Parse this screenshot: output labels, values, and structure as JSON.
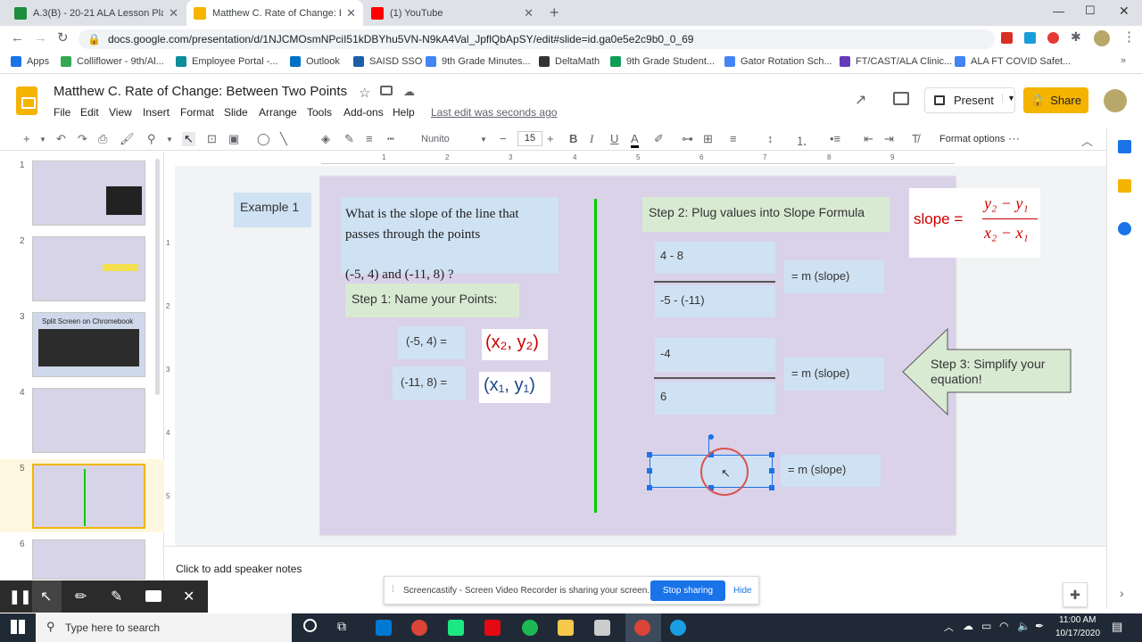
{
  "browser": {
    "tabs": [
      {
        "title": "A.3(B) - 20-21 ALA Lesson Plans/",
        "active": false
      },
      {
        "title": "Matthew C. Rate of Change: Betw",
        "active": true
      },
      {
        "title": "(1) YouTube",
        "active": false
      }
    ],
    "url": "docs.google.com/presentation/d/1NJCMOsmNPciI51kDBYhu5VN-N9kA4Val_JpflQbApSY/edit#slide=id.ga0e5e2c9b0_0_69",
    "bookmarks": [
      "Apps",
      "Colliflower - 9th/Al...",
      "Employee Portal -...",
      "Outlook",
      "SAISD SSO",
      "9th Grade Minutes...",
      "DeltaMath",
      "9th Grade Student...",
      "Gator Rotation Sch...",
      "FT/CAST/ALA Clinic...",
      "ALA FT COVID Safet..."
    ]
  },
  "doc": {
    "title": "Matthew C. Rate of Change: Between Two Points",
    "menus": [
      "File",
      "Edit",
      "View",
      "Insert",
      "Format",
      "Slide",
      "Arrange",
      "Tools",
      "Add-ons",
      "Help"
    ],
    "last_edit": "Last edit was seconds ago",
    "present_label": "Present",
    "share_label": "Share"
  },
  "toolbar": {
    "font": "Nunito",
    "font_size": "15",
    "format_options": "Format options"
  },
  "ruler": [
    "1",
    "2",
    "3",
    "4",
    "5",
    "6",
    "7",
    "8",
    "9"
  ],
  "vruler": [
    "1",
    "2",
    "3",
    "4",
    "5"
  ],
  "filmstrip": {
    "numbers": [
      "1",
      "2",
      "3",
      "4",
      "5",
      "6"
    ],
    "thumb3_title": "Split Screen on Chromebook"
  },
  "slide": {
    "example_label": "Example 1",
    "question": "What is the slope of the line that passes through the points",
    "points": "(-5, 4) and (-11, 8) ?",
    "step1": "Step 1: Name your Points:",
    "p1": "(-5, 4) =",
    "p2": "(-11, 8) =",
    "p1_name": "(x₂, y₂)",
    "p2_name": "(x₁, y₁)",
    "step2": "Step 2: Plug values into Slope Formula",
    "slope_word": "slope =",
    "formula_num": "y₂ − y₁",
    "formula_den": "x₂ − x₁",
    "frac1_num": "4 - 8",
    "frac1_den": "-5 - (-11)",
    "frac2_num": "-4",
    "frac2_den": "6",
    "m_slope": "= m (slope)",
    "step3": "Step 3: Simplify your equation!"
  },
  "notes_placeholder": "Click to add speaker notes",
  "screencastify": {
    "message": "Screencastify - Screen Video Recorder is sharing your screen.",
    "stop": "Stop sharing",
    "hide": "Hide"
  },
  "taskbar": {
    "search_placeholder": "Type here to search",
    "time": "11:00 AM",
    "date": "10/17/2020"
  },
  "colors": {
    "accent_yellow": "#f4b400",
    "slide_bg": "#d9d2e9",
    "box_blue": "#cfe2f3",
    "box_green": "#d9ead3",
    "divider_green": "#00cc00",
    "formula_red": "#cc0000"
  }
}
